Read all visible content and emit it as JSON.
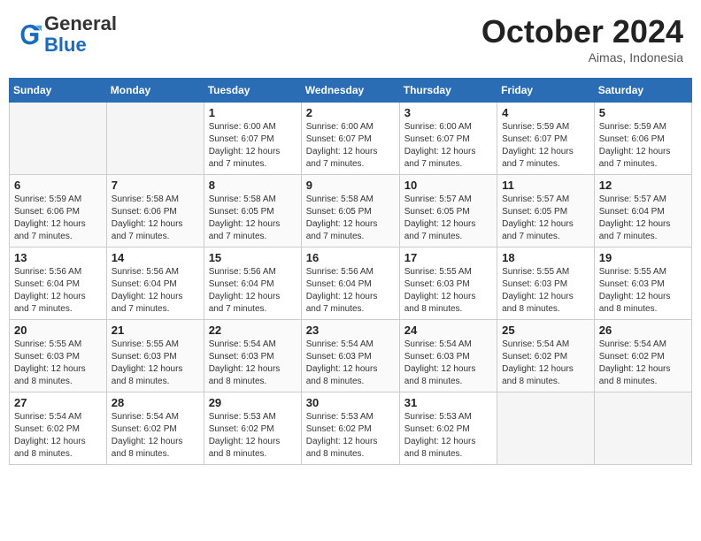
{
  "header": {
    "logo": {
      "line1": "General",
      "line2": "Blue"
    },
    "title": "October 2024",
    "location": "Aimas, Indonesia"
  },
  "weekdays": [
    "Sunday",
    "Monday",
    "Tuesday",
    "Wednesday",
    "Thursday",
    "Friday",
    "Saturday"
  ],
  "weeks": [
    [
      {
        "day": null
      },
      {
        "day": null
      },
      {
        "day": "1",
        "sunrise": "Sunrise: 6:00 AM",
        "sunset": "Sunset: 6:07 PM",
        "daylight": "Daylight: 12 hours and 7 minutes."
      },
      {
        "day": "2",
        "sunrise": "Sunrise: 6:00 AM",
        "sunset": "Sunset: 6:07 PM",
        "daylight": "Daylight: 12 hours and 7 minutes."
      },
      {
        "day": "3",
        "sunrise": "Sunrise: 6:00 AM",
        "sunset": "Sunset: 6:07 PM",
        "daylight": "Daylight: 12 hours and 7 minutes."
      },
      {
        "day": "4",
        "sunrise": "Sunrise: 5:59 AM",
        "sunset": "Sunset: 6:07 PM",
        "daylight": "Daylight: 12 hours and 7 minutes."
      },
      {
        "day": "5",
        "sunrise": "Sunrise: 5:59 AM",
        "sunset": "Sunset: 6:06 PM",
        "daylight": "Daylight: 12 hours and 7 minutes."
      }
    ],
    [
      {
        "day": "6",
        "sunrise": "Sunrise: 5:59 AM",
        "sunset": "Sunset: 6:06 PM",
        "daylight": "Daylight: 12 hours and 7 minutes."
      },
      {
        "day": "7",
        "sunrise": "Sunrise: 5:58 AM",
        "sunset": "Sunset: 6:06 PM",
        "daylight": "Daylight: 12 hours and 7 minutes."
      },
      {
        "day": "8",
        "sunrise": "Sunrise: 5:58 AM",
        "sunset": "Sunset: 6:05 PM",
        "daylight": "Daylight: 12 hours and 7 minutes."
      },
      {
        "day": "9",
        "sunrise": "Sunrise: 5:58 AM",
        "sunset": "Sunset: 6:05 PM",
        "daylight": "Daylight: 12 hours and 7 minutes."
      },
      {
        "day": "10",
        "sunrise": "Sunrise: 5:57 AM",
        "sunset": "Sunset: 6:05 PM",
        "daylight": "Daylight: 12 hours and 7 minutes."
      },
      {
        "day": "11",
        "sunrise": "Sunrise: 5:57 AM",
        "sunset": "Sunset: 6:05 PM",
        "daylight": "Daylight: 12 hours and 7 minutes."
      },
      {
        "day": "12",
        "sunrise": "Sunrise: 5:57 AM",
        "sunset": "Sunset: 6:04 PM",
        "daylight": "Daylight: 12 hours and 7 minutes."
      }
    ],
    [
      {
        "day": "13",
        "sunrise": "Sunrise: 5:56 AM",
        "sunset": "Sunset: 6:04 PM",
        "daylight": "Daylight: 12 hours and 7 minutes."
      },
      {
        "day": "14",
        "sunrise": "Sunrise: 5:56 AM",
        "sunset": "Sunset: 6:04 PM",
        "daylight": "Daylight: 12 hours and 7 minutes."
      },
      {
        "day": "15",
        "sunrise": "Sunrise: 5:56 AM",
        "sunset": "Sunset: 6:04 PM",
        "daylight": "Daylight: 12 hours and 7 minutes."
      },
      {
        "day": "16",
        "sunrise": "Sunrise: 5:56 AM",
        "sunset": "Sunset: 6:04 PM",
        "daylight": "Daylight: 12 hours and 7 minutes."
      },
      {
        "day": "17",
        "sunrise": "Sunrise: 5:55 AM",
        "sunset": "Sunset: 6:03 PM",
        "daylight": "Daylight: 12 hours and 8 minutes."
      },
      {
        "day": "18",
        "sunrise": "Sunrise: 5:55 AM",
        "sunset": "Sunset: 6:03 PM",
        "daylight": "Daylight: 12 hours and 8 minutes."
      },
      {
        "day": "19",
        "sunrise": "Sunrise: 5:55 AM",
        "sunset": "Sunset: 6:03 PM",
        "daylight": "Daylight: 12 hours and 8 minutes."
      }
    ],
    [
      {
        "day": "20",
        "sunrise": "Sunrise: 5:55 AM",
        "sunset": "Sunset: 6:03 PM",
        "daylight": "Daylight: 12 hours and 8 minutes."
      },
      {
        "day": "21",
        "sunrise": "Sunrise: 5:55 AM",
        "sunset": "Sunset: 6:03 PM",
        "daylight": "Daylight: 12 hours and 8 minutes."
      },
      {
        "day": "22",
        "sunrise": "Sunrise: 5:54 AM",
        "sunset": "Sunset: 6:03 PM",
        "daylight": "Daylight: 12 hours and 8 minutes."
      },
      {
        "day": "23",
        "sunrise": "Sunrise: 5:54 AM",
        "sunset": "Sunset: 6:03 PM",
        "daylight": "Daylight: 12 hours and 8 minutes."
      },
      {
        "day": "24",
        "sunrise": "Sunrise: 5:54 AM",
        "sunset": "Sunset: 6:03 PM",
        "daylight": "Daylight: 12 hours and 8 minutes."
      },
      {
        "day": "25",
        "sunrise": "Sunrise: 5:54 AM",
        "sunset": "Sunset: 6:02 PM",
        "daylight": "Daylight: 12 hours and 8 minutes."
      },
      {
        "day": "26",
        "sunrise": "Sunrise: 5:54 AM",
        "sunset": "Sunset: 6:02 PM",
        "daylight": "Daylight: 12 hours and 8 minutes."
      }
    ],
    [
      {
        "day": "27",
        "sunrise": "Sunrise: 5:54 AM",
        "sunset": "Sunset: 6:02 PM",
        "daylight": "Daylight: 12 hours and 8 minutes."
      },
      {
        "day": "28",
        "sunrise": "Sunrise: 5:54 AM",
        "sunset": "Sunset: 6:02 PM",
        "daylight": "Daylight: 12 hours and 8 minutes."
      },
      {
        "day": "29",
        "sunrise": "Sunrise: 5:53 AM",
        "sunset": "Sunset: 6:02 PM",
        "daylight": "Daylight: 12 hours and 8 minutes."
      },
      {
        "day": "30",
        "sunrise": "Sunrise: 5:53 AM",
        "sunset": "Sunset: 6:02 PM",
        "daylight": "Daylight: 12 hours and 8 minutes."
      },
      {
        "day": "31",
        "sunrise": "Sunrise: 5:53 AM",
        "sunset": "Sunset: 6:02 PM",
        "daylight": "Daylight: 12 hours and 8 minutes."
      },
      {
        "day": null
      },
      {
        "day": null
      }
    ]
  ]
}
